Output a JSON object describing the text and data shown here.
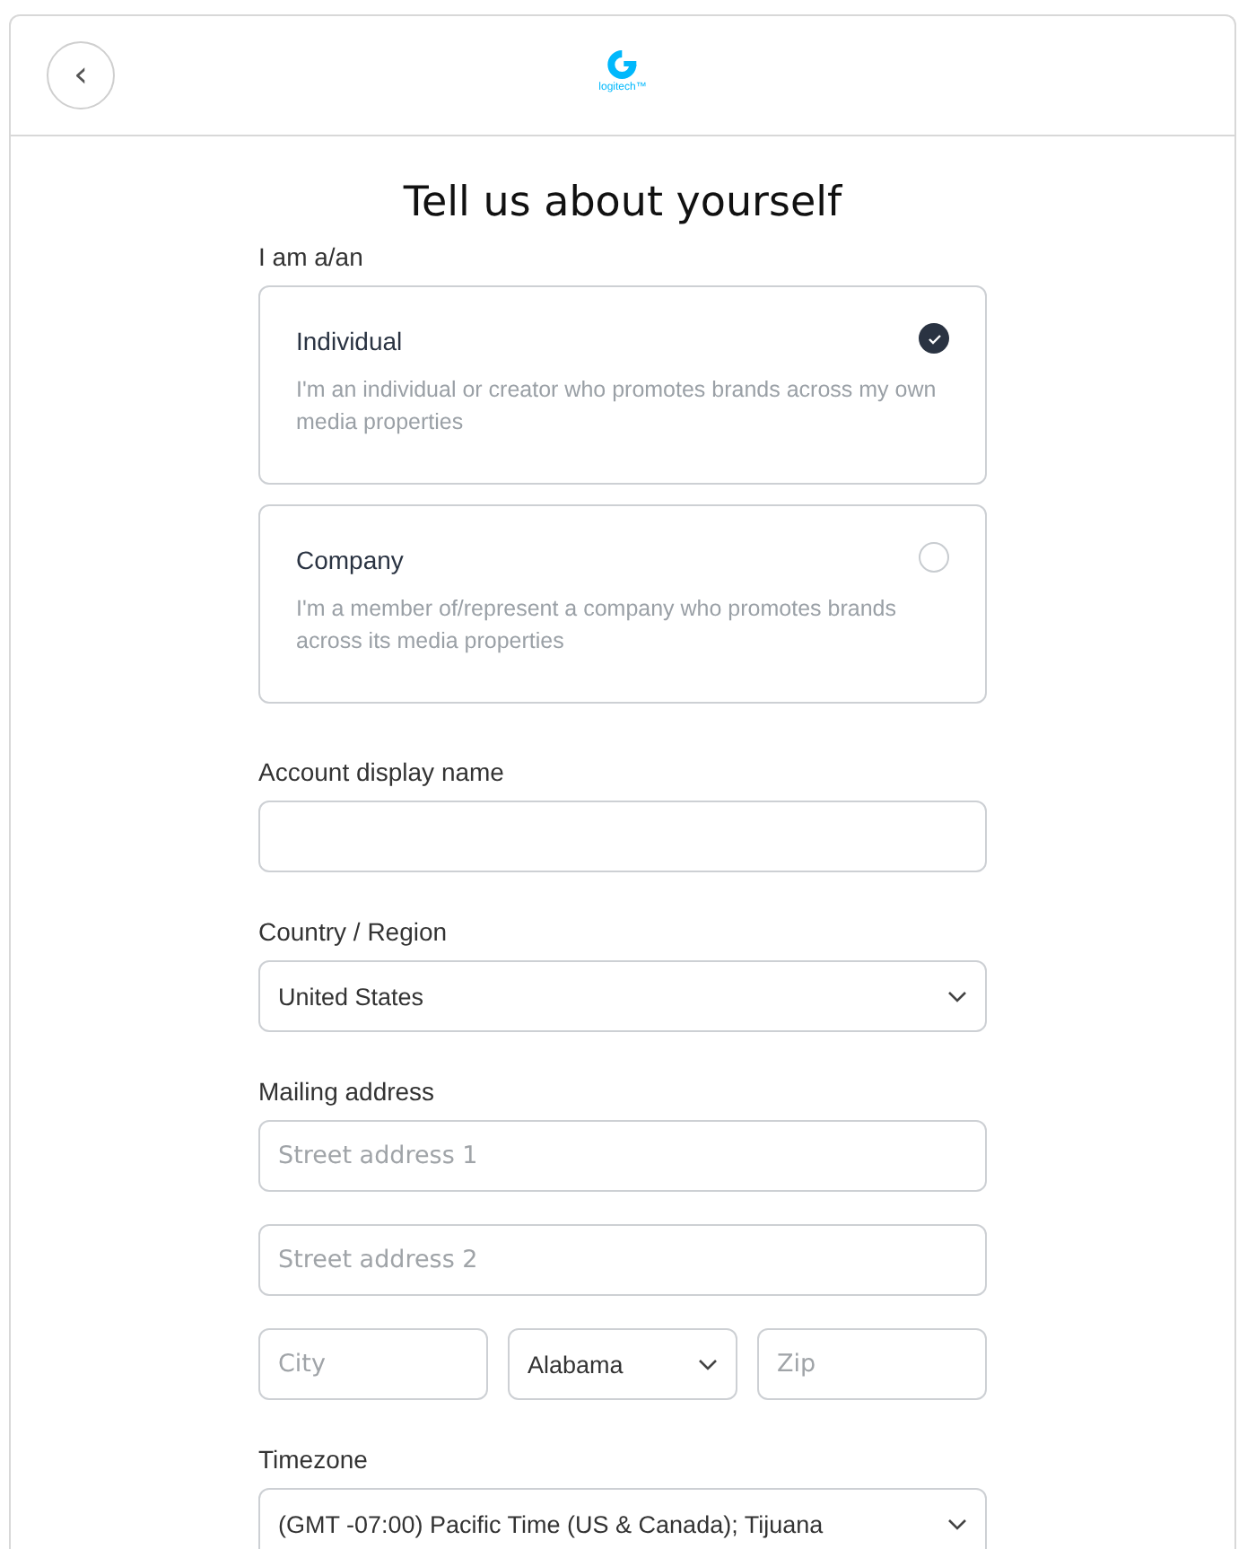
{
  "header": {
    "back": "‹",
    "brand": "logitech™"
  },
  "title": "Tell us about yourself",
  "account_type": {
    "label": "I am a/an",
    "options": [
      {
        "title": "Individual",
        "description": "I'm an individual or creator who promotes brands across my own media properties",
        "selected": true
      },
      {
        "title": "Company",
        "description": "I'm a member of/represent a company who promotes brands across its media properties",
        "selected": false
      }
    ]
  },
  "groups": [
    {
      "label": "Account display name",
      "rows": [
        [
          {
            "kind": "text"
          }
        ]
      ]
    },
    {
      "label": "Country / Region",
      "rows": [
        [
          {
            "kind": "select",
            "value": "United States"
          }
        ]
      ]
    },
    {
      "label": "Mailing address",
      "rows": [
        [
          {
            "kind": "text",
            "placeholder": "Street address 1"
          }
        ],
        [
          {
            "kind": "text",
            "placeholder": "Street address 2"
          }
        ],
        [
          {
            "kind": "text",
            "placeholder": "City"
          },
          {
            "kind": "select",
            "value": "Alabama"
          },
          {
            "kind": "text",
            "placeholder": "Zip"
          }
        ]
      ]
    },
    {
      "label": "Timezone",
      "rows": [
        [
          {
            "kind": "select",
            "value": "(GMT -07:00) Pacific Time (US & Canada); Tijuana"
          }
        ]
      ]
    }
  ]
}
